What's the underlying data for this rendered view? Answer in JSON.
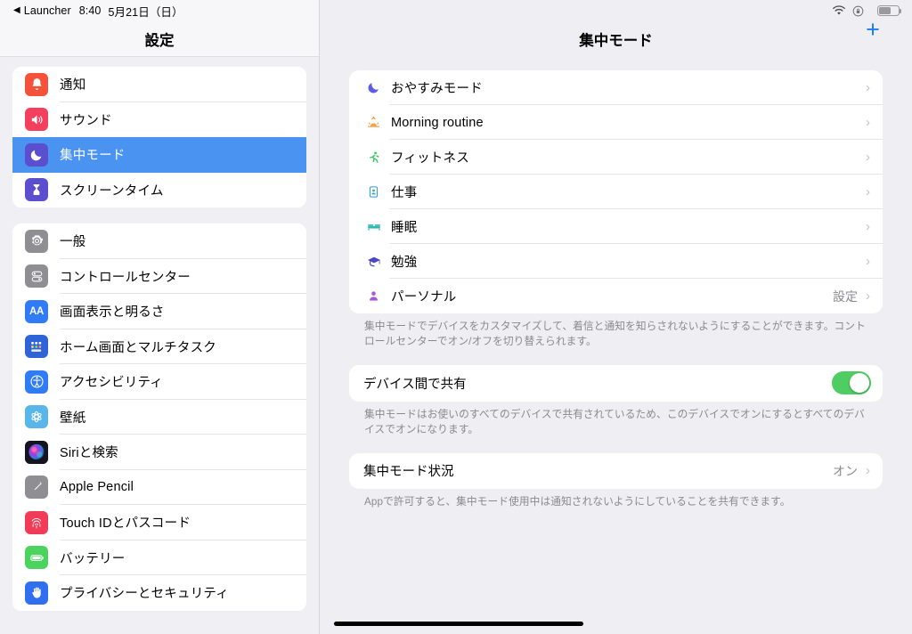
{
  "status_bar": {
    "back_app": "Launcher",
    "back_caret": "◀",
    "time": "8:40",
    "date": "5月21日（日）",
    "wifi_icon": "wifi-icon",
    "orientation_lock_icon": "rotation-lock-icon",
    "battery_icon": "battery-icon"
  },
  "sidebar": {
    "title": "設定",
    "groups": [
      {
        "items": [
          {
            "label": "通知",
            "icon": "notifications-icon",
            "color": "#f4523b",
            "selected": false
          },
          {
            "label": "サウンド",
            "icon": "sound-icon",
            "color": "#f43f5e",
            "selected": false
          },
          {
            "label": "集中モード",
            "icon": "focus-moon-icon",
            "color": "#5b4fd0",
            "selected": true
          },
          {
            "label": "スクリーンタイム",
            "icon": "screentime-icon",
            "color": "#5b4fd0",
            "selected": false
          }
        ]
      },
      {
        "items": [
          {
            "label": "一般",
            "icon": "gear-icon",
            "color": "#8e8e93",
            "selected": false
          },
          {
            "label": "コントロールセンター",
            "icon": "control-center-icon",
            "color": "#8e8e93",
            "selected": false
          },
          {
            "label": "画面表示と明るさ",
            "icon": "display-brightness-icon",
            "color": "#2f7cf6",
            "selected": false
          },
          {
            "label": "ホーム画面とマルチタスク",
            "icon": "home-screen-icon",
            "color": "#2f63d8",
            "selected": false
          },
          {
            "label": "アクセシビリティ",
            "icon": "accessibility-icon",
            "color": "#2f7cf6",
            "selected": false
          },
          {
            "label": "壁紙",
            "icon": "wallpaper-icon",
            "color": "#58b6e8",
            "selected": false
          },
          {
            "label": "Siriと検索",
            "icon": "siri-icon",
            "color": "#1b1b2a",
            "selected": false
          },
          {
            "label": "Apple Pencil",
            "icon": "apple-pencil-icon",
            "color": "#8e8e93",
            "selected": false
          },
          {
            "label": "Touch IDとパスコード",
            "icon": "touch-id-icon",
            "color": "#f23b56",
            "selected": false
          },
          {
            "label": "バッテリー",
            "icon": "battery-settings-icon",
            "color": "#4cd35f",
            "selected": false
          },
          {
            "label": "プライバシーとセキュリティ",
            "icon": "privacy-hand-icon",
            "color": "#2f6ff0",
            "selected": false
          }
        ]
      }
    ]
  },
  "main": {
    "title": "集中モード",
    "add_button_label": "+",
    "focus_modes": [
      {
        "label": "おやすみモード",
        "icon": "moon-icon",
        "color": "#5e5ce6",
        "value": ""
      },
      {
        "label": "Morning routine",
        "icon": "sunrise-icon",
        "color": "#f09030",
        "value": ""
      },
      {
        "label": "フィットネス",
        "icon": "fitness-runner-icon",
        "color": "#34c759",
        "value": ""
      },
      {
        "label": "仕事",
        "icon": "work-badge-icon",
        "color": "#32a0c8",
        "value": ""
      },
      {
        "label": "睡眠",
        "icon": "sleep-bed-icon",
        "color": "#2fb8b0",
        "value": ""
      },
      {
        "label": "勉強",
        "icon": "study-cap-icon",
        "color": "#4a46c8",
        "value": ""
      },
      {
        "label": "パーソナル",
        "icon": "person-icon",
        "color": "#a855d8",
        "value": "設定"
      }
    ],
    "focus_footnote": "集中モードでデバイスをカスタマイズして、着信と通知を知らされないようにすることができます。コントロールセンターでオン/オフを切り替えられます。",
    "share_across_devices": {
      "label": "デバイス間で共有",
      "toggle_on": true,
      "toggle_color": "#4ecd63"
    },
    "share_footnote": "集中モードはお使いのすべてのデバイスで共有されているため、このデバイスでオンにするとすべてのデバイスでオンになります。",
    "focus_status": {
      "label": "集中モード状況",
      "value": "オン"
    },
    "status_footnote": "Appで許可すると、集中モード使用中は通知されないようにしていることを共有できます。"
  }
}
